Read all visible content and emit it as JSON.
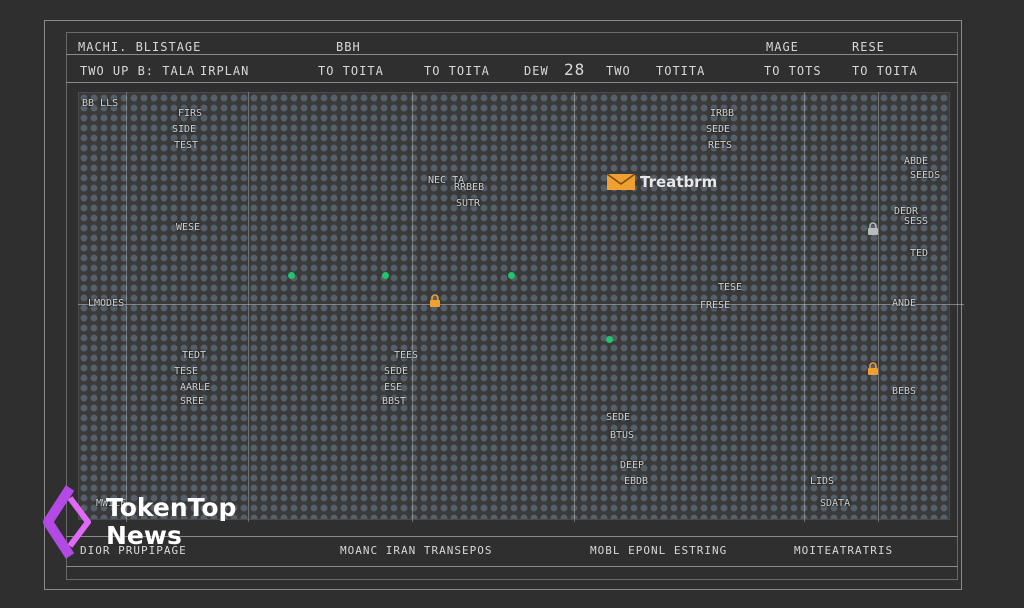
{
  "header": {
    "row1": [
      "MACHI. BLISTAGE",
      "BBH",
      "MAGE",
      "RESE"
    ],
    "row2": [
      "TWO UP B: TALA",
      "IRPLAN",
      "TO TOITA",
      "TO TOITA",
      "DEW",
      "28",
      "TWO",
      "TOTITA",
      "TO TOTS",
      "TO TOITA"
    ]
  },
  "grid_labels": [
    "BB LLS",
    "FIRS",
    "SIDE",
    "TEST",
    "IRBB",
    "SEDE",
    "RETS",
    "NEC TA",
    "SUTR",
    "ABDE",
    "WESE",
    "DEDR",
    "TED",
    "LMODES",
    "ANDE",
    "TESE",
    "TEDT",
    "TESE",
    "AARLE",
    "TEES",
    "SEDE",
    "ESE",
    "BEBS",
    "SEDE",
    "DEEP",
    "LIDS",
    "RRBEB",
    "BTUS",
    "SEEDS",
    "MWILE",
    "SDATA",
    "FRESE",
    "SREE",
    "BBST",
    "SESS",
    "EBDB"
  ],
  "brand": {
    "name": "Treatbrm"
  },
  "logo": {
    "line1": "TokenTop",
    "line2": "News"
  },
  "footer": [
    "DIOR PRUPIPAGE",
    "MOANC IRAN TRANSEPOS",
    "MOBL EPONL ESTRING",
    "MOITEATRATRIS"
  ],
  "colors": {
    "background": "#2f2f2f",
    "accent_green": "#21c46a",
    "accent_orange": "#f0a030",
    "logo_purple": "#b44ae6"
  }
}
